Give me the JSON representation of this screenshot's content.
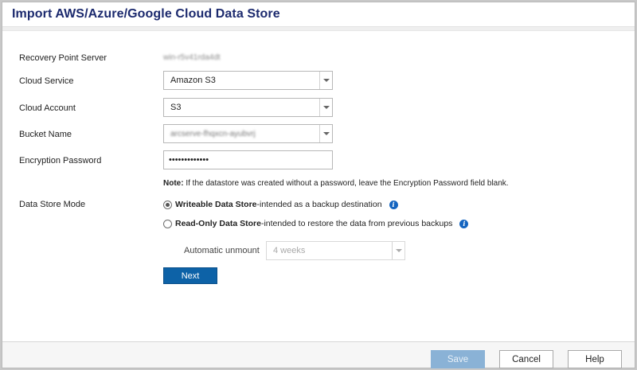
{
  "dialog": {
    "title": "Import AWS/Azure/Google Cloud Data Store"
  },
  "form": {
    "recovery_point_server": {
      "label": "Recovery Point Server",
      "value": "win-r5v41rda4dt"
    },
    "cloud_service": {
      "label": "Cloud Service",
      "value": "Amazon S3"
    },
    "cloud_account": {
      "label": "Cloud Account",
      "value": "S3"
    },
    "bucket_name": {
      "label": "Bucket Name",
      "value": "arcserve-fhqxcn-ayubvrj"
    },
    "encryption_password": {
      "label": "Encryption Password",
      "value": "•••••••••••••"
    },
    "note": {
      "prefix": "Note:",
      "text": " If the datastore was created without a password, leave the Encryption Password field blank."
    },
    "data_store_mode": {
      "label": "Data Store Mode",
      "options": [
        {
          "title": "Writeable Data Store",
          "desc": "-intended as a backup destination",
          "selected": true
        },
        {
          "title": "Read-Only Data Store",
          "desc": "-intended to restore the data from previous backups",
          "selected": false
        }
      ]
    },
    "automatic_unmount": {
      "label": "Automatic unmount",
      "value": "4 weeks"
    },
    "next_label": "Next"
  },
  "footer": {
    "save_label": "Save",
    "cancel_label": "Cancel",
    "help_label": "Help"
  },
  "icons": {
    "info": "info-icon",
    "dropdown": "chevron-down-icon"
  },
  "colors": {
    "title": "#1c2a6e",
    "primary": "#0d62a7",
    "disabled_primary": "#8ab2d6",
    "info": "#1565c0"
  }
}
